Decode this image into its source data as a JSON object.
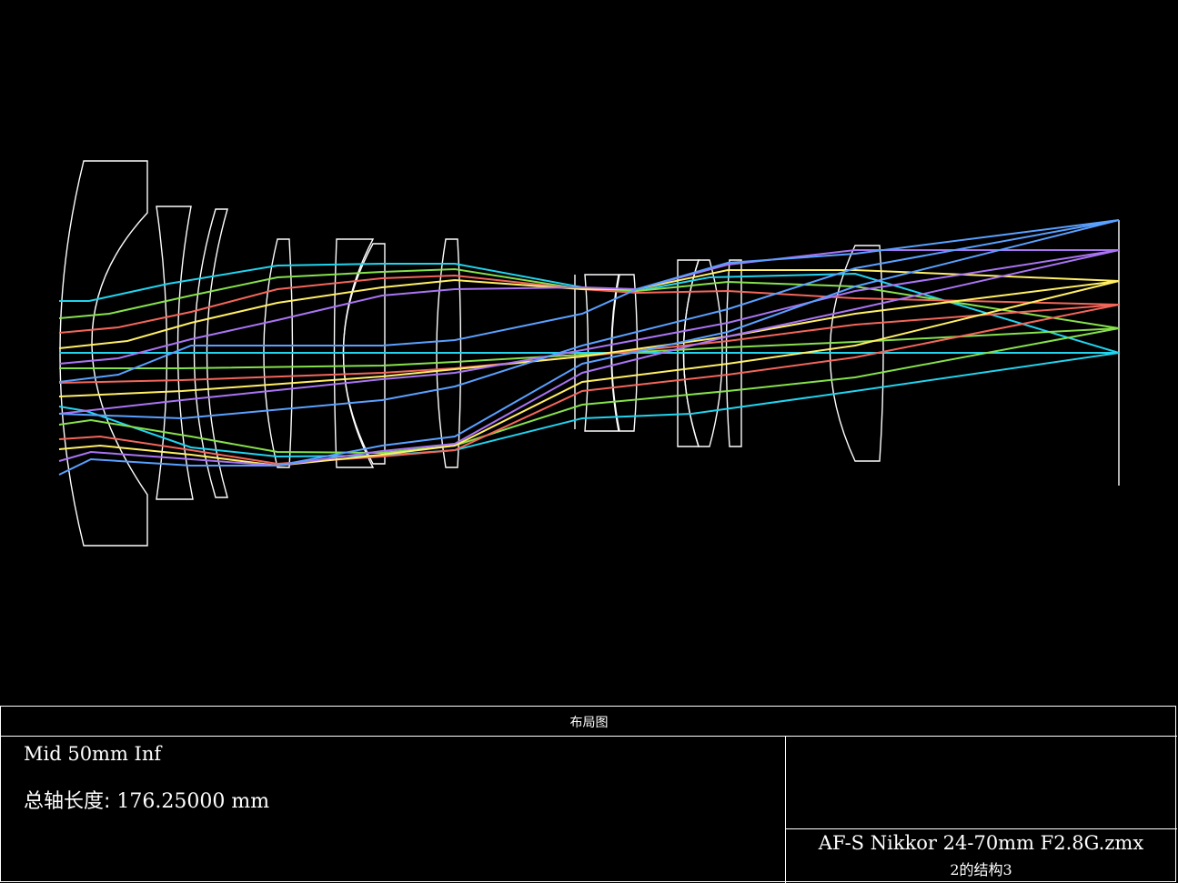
{
  "header_label": "布局图",
  "config_label": "Mid 50mm Inf",
  "total_length": {
    "label": "总轴长度:",
    "value": "176.25000 mm"
  },
  "file_name": "AF-S Nikkor 24-70mm F2.8G.zmx",
  "configuration": "2的结构3",
  "colors": {
    "background": "#000000",
    "lens": "#ffffff",
    "field1": "#22d3ee",
    "field2": "#86e04c",
    "field3": "#f2665a",
    "field4": "#ffee66",
    "field5": "#a974f2",
    "field6": "#5aa0ff"
  }
}
